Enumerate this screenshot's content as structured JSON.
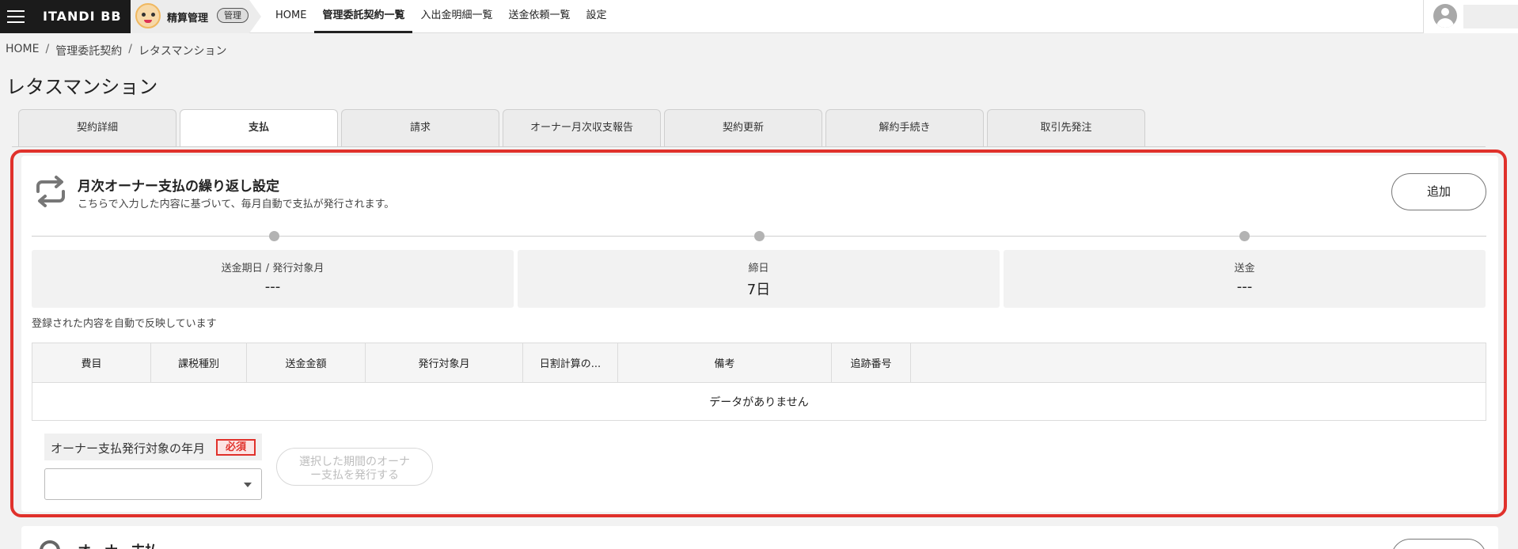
{
  "header": {
    "brand": "ITANDI BB",
    "app_name": "精算管理",
    "app_badge": "管理",
    "nav": [
      {
        "label": "HOME"
      },
      {
        "label": "管理委託契約一覧",
        "active": true
      },
      {
        "label": "入出金明細一覧"
      },
      {
        "label": "送金依頼一覧"
      },
      {
        "label": "設定"
      }
    ]
  },
  "breadcrumb": [
    "HOME",
    "管理委託契約",
    "レタスマンション"
  ],
  "page_title": "レタスマンション",
  "tabs": [
    {
      "label": "契約詳細"
    },
    {
      "label": "支払",
      "active": true
    },
    {
      "label": "請求"
    },
    {
      "label": "オーナー月次収支報告"
    },
    {
      "label": "契約更新"
    },
    {
      "label": "解約手続き"
    },
    {
      "label": "取引先発注"
    }
  ],
  "recurring": {
    "title": "月次オーナー支払の繰り返し設定",
    "subtitle": "こちらで入力した内容に基づいて、毎月自動で支払が発行されます。",
    "add_label": "追加",
    "summary": [
      {
        "label": "送金期日 / 発行対象月",
        "value": "---"
      },
      {
        "label": "締日",
        "value": "7日"
      },
      {
        "label": "送金",
        "value": "---"
      }
    ],
    "note": "登録された内容を自動で反映しています",
    "table": {
      "columns": [
        "費目",
        "課税種別",
        "送金金額",
        "発行対象月",
        "日割計算の...",
        "備考",
        "追跡番号"
      ],
      "empty_text": "データがありません"
    },
    "form": {
      "label": "オーナー支払発行対象の年月",
      "required": "必須",
      "select_value": "",
      "issue_button_line1": "選択した期間のオーナ",
      "issue_button_line2": "ー支払を発行する"
    }
  },
  "next_card": {
    "title": "オーナー支払"
  },
  "colors": {
    "highlight": "#e0312b",
    "brand_bg": "#1b1b1b"
  }
}
